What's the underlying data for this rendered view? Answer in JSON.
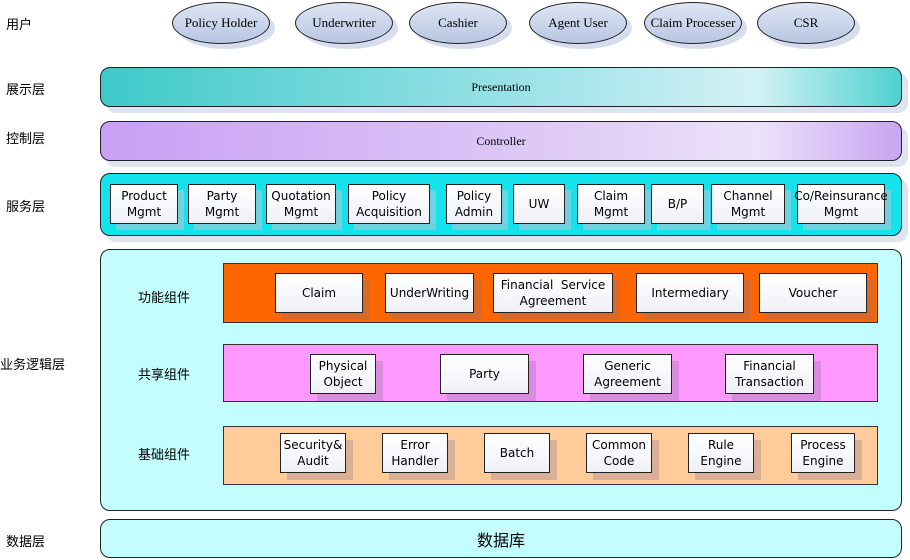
{
  "layers": {
    "users": "用户",
    "presentation": "展示层",
    "control": "控制层",
    "service": "服务层",
    "business_logic": "业务逻辑层",
    "data": "数据层"
  },
  "users": [
    "Policy Holder",
    "Underwriter",
    "Cashier",
    "Agent User",
    "Claim Processer",
    "CSR"
  ],
  "presentation_bar": "Presentation",
  "controller_bar": "Controller",
  "services": [
    "Product Mgmt",
    "Party Mgmt",
    "Quotation Mgmt",
    "Policy Acquisition",
    "Policy Admin",
    "UW",
    "Claim Mgmt",
    "B/P",
    "Channel Mgmt",
    "Co/Reinsurance Mgmt"
  ],
  "business_logic": {
    "functional": {
      "label": "功能组件",
      "items": [
        "Claim",
        "UnderWriting",
        "Financial  Service Agreement",
        "Intermediary",
        "Voucher"
      ]
    },
    "shared": {
      "label": "共享组件",
      "items": [
        "Physical Object",
        "Party",
        "Generic Agreement",
        "Financial Transaction"
      ]
    },
    "base": {
      "label": "基础组件",
      "items": [
        "Security& Audit",
        "Error Handler",
        "Batch",
        "Common Code",
        "Rule Engine",
        "Process Engine"
      ]
    }
  },
  "database_bar": "数据库",
  "colors": {
    "presentation": "#3ec9c9",
    "controller": "#c99ff5",
    "service": "#14e3ee",
    "logic_bg": "#c4fdfd",
    "functional": "#ff6600",
    "shared": "#ff99ff",
    "base": "#ffcc99"
  }
}
